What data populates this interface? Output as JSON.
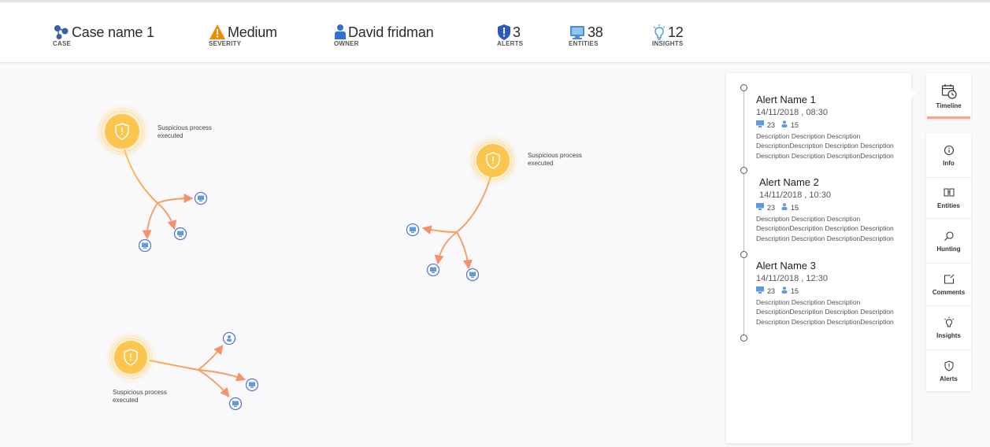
{
  "header": {
    "case": {
      "value": "Case name 1",
      "label": "CASE",
      "icon": "case-graph-icon"
    },
    "severity": {
      "value": "Medium",
      "label": "SEVERITY",
      "icon": "warning-icon",
      "color": "#f08c00"
    },
    "owner": {
      "value": "David fridman",
      "label": "OWNER",
      "icon": "user-icon"
    },
    "alerts": {
      "value": "3",
      "label": "ALERTS",
      "icon": "shield-alert-icon"
    },
    "entities": {
      "value": "38",
      "label": "ENTITIES",
      "icon": "computer-icon"
    },
    "insights": {
      "value": "12",
      "label": "INSIGHTS",
      "icon": "lightbulb-icon"
    }
  },
  "graph": {
    "nodes": [
      {
        "label": "Suspicious process executed",
        "label_lines": [
          "Suspicious process",
          "executed"
        ]
      },
      {
        "label": "Suspicious process executed",
        "label_lines": [
          "Suspicious process",
          "executed"
        ]
      },
      {
        "label": "Suspicious process executed",
        "label_lines": [
          "Suspicious process",
          "executed"
        ]
      }
    ],
    "colors": {
      "alert_node": "#fcc54e",
      "edge_start": "#fcc54e",
      "edge_end": "#f5916c",
      "entity_ring": "#5a76d6"
    }
  },
  "timeline": {
    "alerts": [
      {
        "name": "Alert Name 1",
        "time": "14/11/2018 , 08:30",
        "computers": "23",
        "users": "15",
        "desc_lines": [
          "Description Description Description",
          "DescriptionDescription Description Description",
          "Description Description DescriptionDescription"
        ]
      },
      {
        "name": "Alert Name 2",
        "time": "14/11/2018 , 10:30",
        "computers": "23",
        "users": "15",
        "desc_lines": [
          "Description Description Description",
          "DescriptionDescription Description Description",
          "Description Description DescriptionDescription"
        ]
      },
      {
        "name": "Alert Name 3",
        "time": "14/11/2018 , 12:30",
        "computers": "23",
        "users": "15",
        "desc_lines": [
          "Description Description Description",
          "DescriptionDescription Description Description",
          "Description Description DescriptionDescription"
        ]
      }
    ]
  },
  "sidebar": {
    "timeline": {
      "label": "Timeline",
      "icon": "calendar-clock-icon",
      "active": true
    },
    "items": [
      {
        "label": "Info",
        "icon": "info-icon"
      },
      {
        "label": "Entities",
        "icon": "entities-icon"
      },
      {
        "label": "Hunting",
        "icon": "search-icon"
      },
      {
        "label": "Comments",
        "icon": "comment-icon"
      },
      {
        "label": "Insights",
        "icon": "lightbulb-icon"
      },
      {
        "label": "Alerts",
        "icon": "shield-alert-icon"
      }
    ]
  }
}
